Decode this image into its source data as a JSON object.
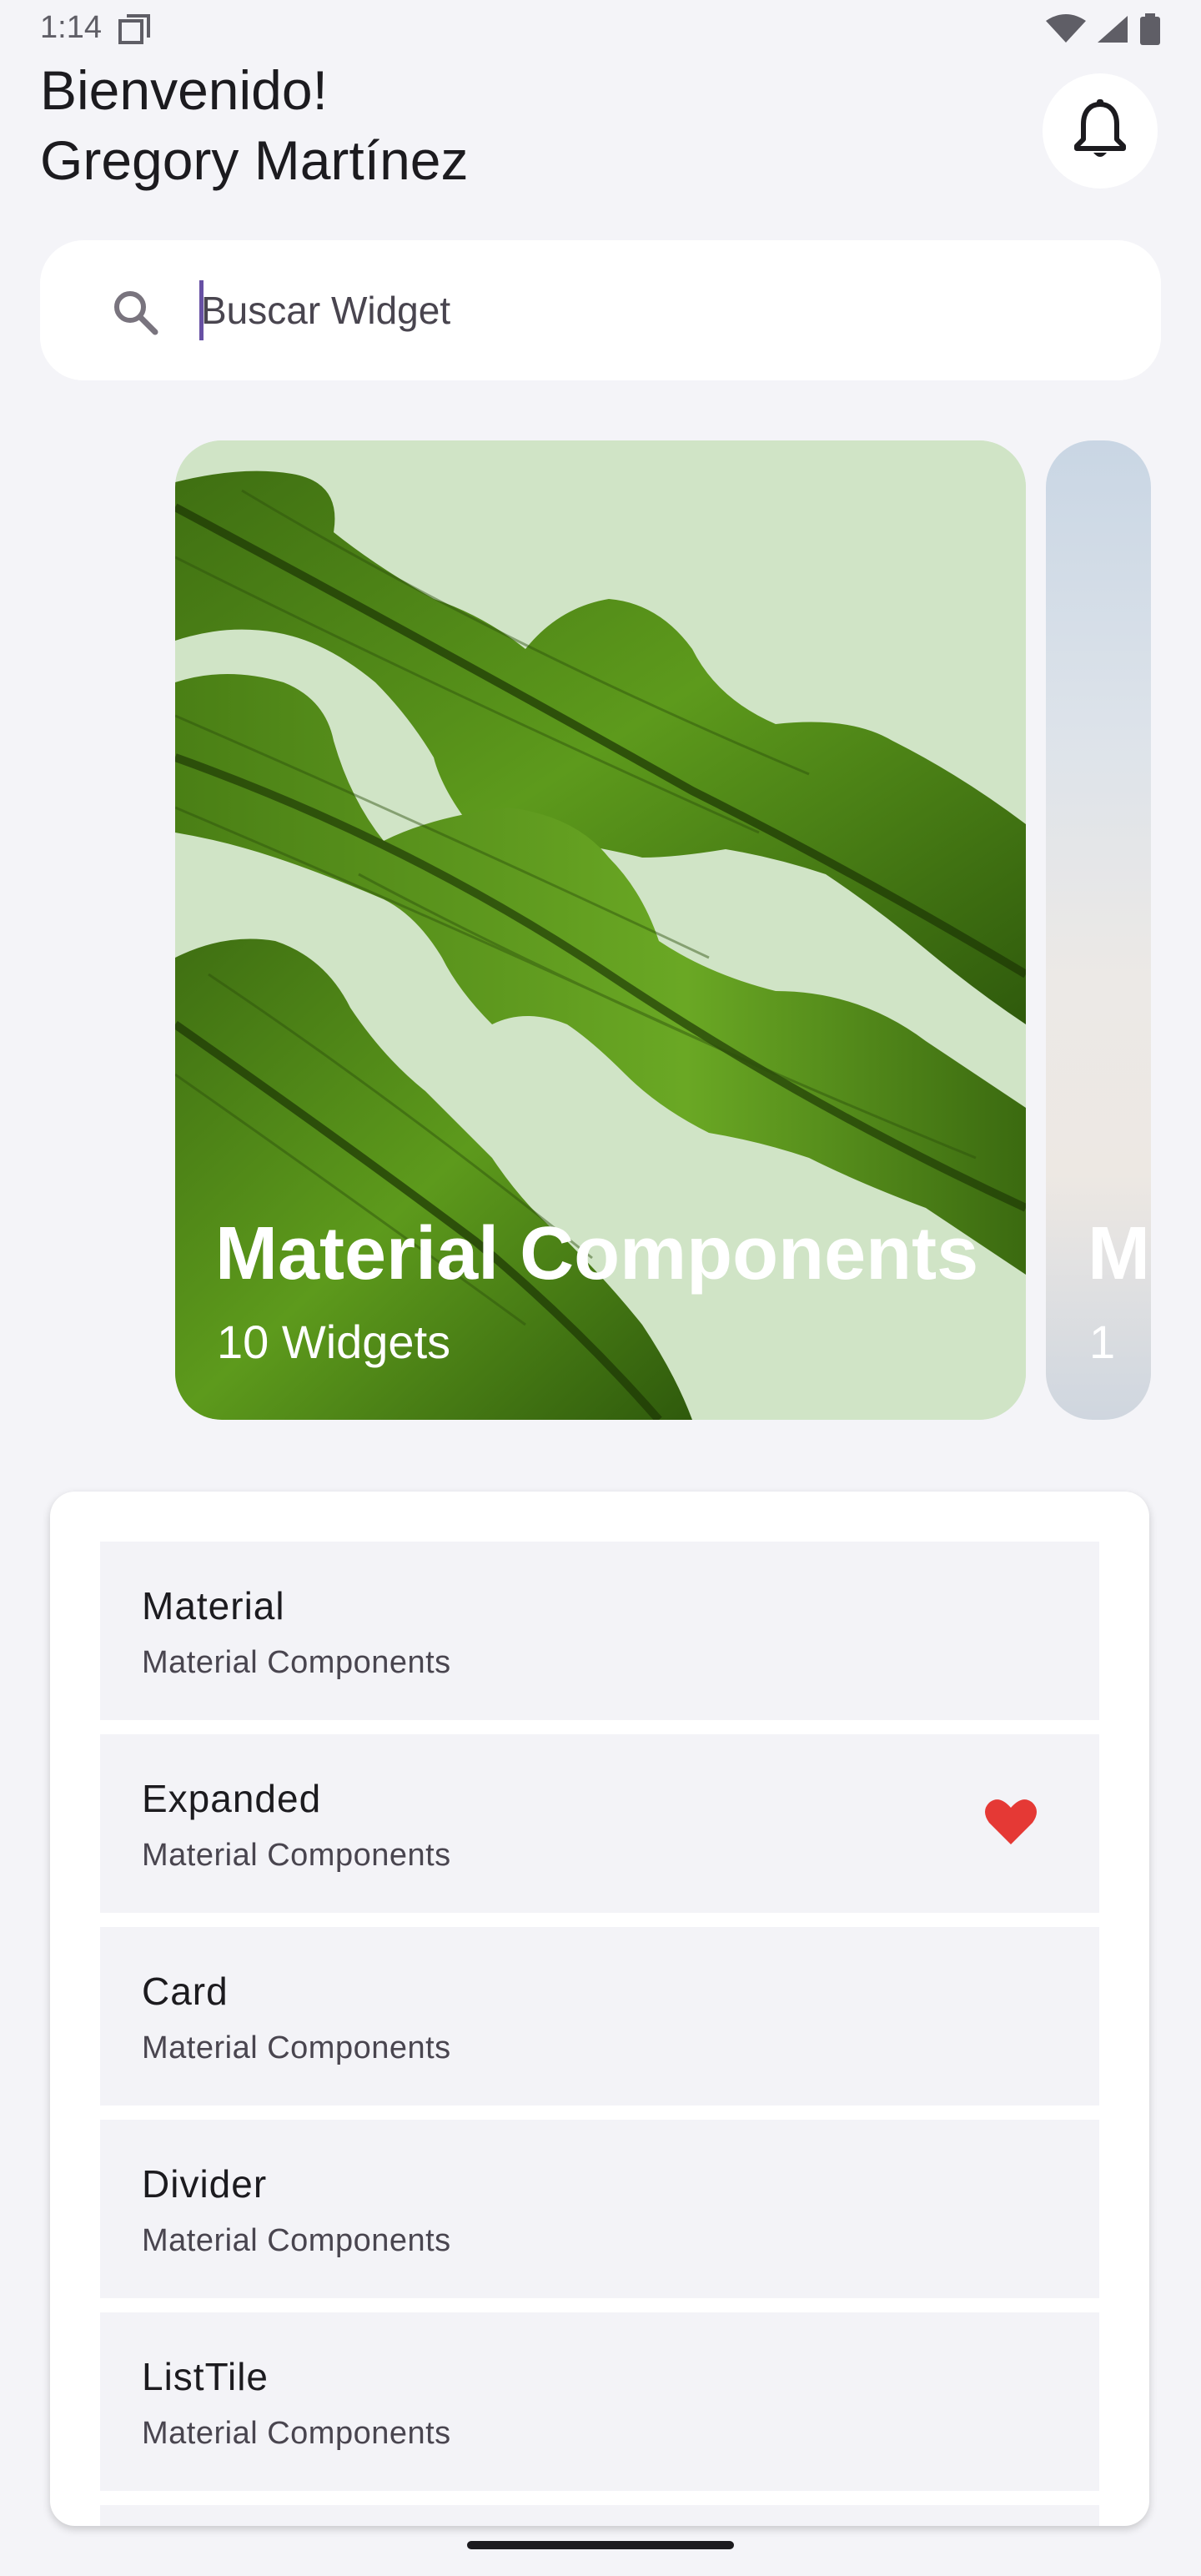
{
  "status_bar": {
    "time": "1:14",
    "icons": [
      "sim-card-icon",
      "wifi-icon",
      "signal-icon",
      "battery-icon"
    ]
  },
  "header": {
    "greeting_line1": "Bienvenido!",
    "greeting_line2": "Gregory Martínez",
    "notification_icon": "bell-icon"
  },
  "search": {
    "icon": "search-icon",
    "placeholder": "Buscar Widget",
    "value": ""
  },
  "carousel": {
    "cards": [
      {
        "title": "Material Components",
        "subtitle": "10 Widgets"
      },
      {
        "title": "M",
        "subtitle": "1"
      }
    ]
  },
  "widget_list": {
    "items": [
      {
        "title": "Material",
        "subtitle": "Material Components",
        "favorite": false
      },
      {
        "title": "Expanded",
        "subtitle": "Material Components",
        "favorite": true
      },
      {
        "title": "Card",
        "subtitle": "Material Components",
        "favorite": false
      },
      {
        "title": "Divider",
        "subtitle": "Material Components",
        "favorite": false
      },
      {
        "title": "ListTile",
        "subtitle": "Material Components",
        "favorite": false
      }
    ]
  },
  "colors": {
    "background": "#f4f4f8",
    "card_leaf_bg": "#d0e4c6",
    "heart": "#e53935",
    "accent": "#6750a4"
  }
}
